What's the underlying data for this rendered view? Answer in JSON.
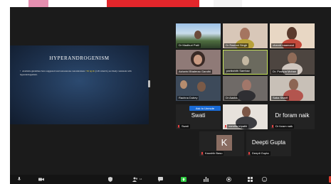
{
  "slide": {
    "title": "HYPERANDROGENISM",
    "bullet": "•",
    "text_before": "Available guidelines have suggested total testosterone concentrations ",
    "text_highlight": ">50 ng/dL",
    "text_after": " (1.81 nmol/L) are likely consistent with hyperandrogenism."
  },
  "participants": [
    {
      "name": "Dr Madhuri Patil",
      "type": "video"
    },
    {
      "name": "Dr Rashmi Singh",
      "type": "video"
    },
    {
      "name": "chandr baamand",
      "type": "video"
    },
    {
      "name": "Ashwini Bhalerao Gandhi",
      "type": "video"
    },
    {
      "name": "parikshith Samhav",
      "type": "video"
    },
    {
      "name": "Dr. Pushpa Mohan",
      "type": "video"
    },
    {
      "name": "Rachna Dubey",
      "type": "video"
    },
    {
      "name": "Dr Aasha",
      "type": "video"
    },
    {
      "name": "Saba Sharif",
      "type": "video"
    },
    {
      "name": "Swati",
      "type": "avatar-name",
      "display": "Swati"
    },
    {
      "name": "nandita tripathi",
      "type": "video"
    },
    {
      "name": "Dr foram naik",
      "type": "avatar-name",
      "display": "Dr foram naik"
    },
    {
      "name": "Kaushik Basu",
      "type": "letter",
      "letter": "K"
    },
    {
      "name": "Deepti Gupta",
      "type": "avatar-name",
      "display": "Deepti Gupta"
    }
  ],
  "ask_button": "Ask to Unmute",
  "toolbar": {
    "participants_count": "14",
    "colors": {
      "bar": "#141414",
      "end": "#d93c2e",
      "accent_green": "#2ecc40"
    }
  }
}
